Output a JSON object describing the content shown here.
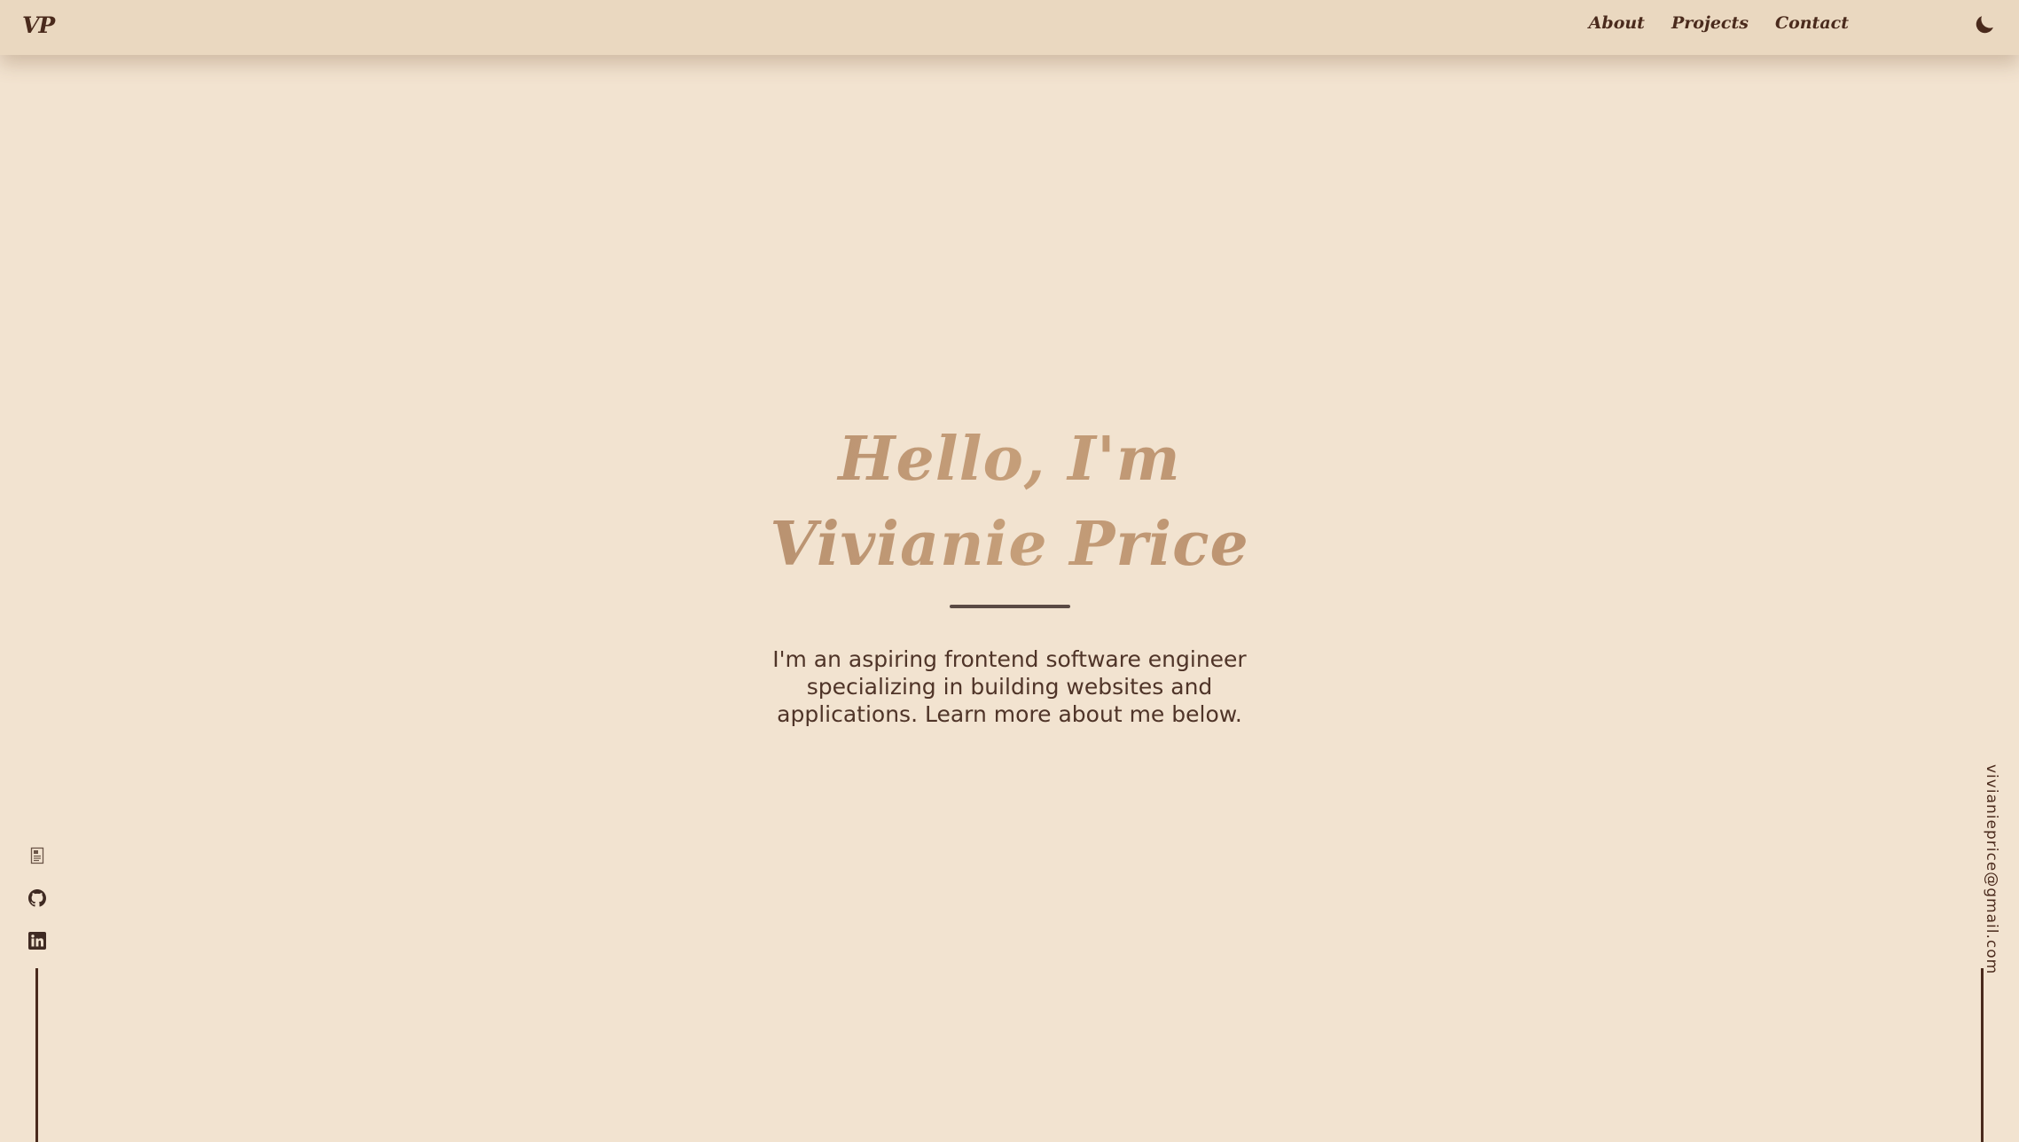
{
  "brand": {
    "logo": "VP"
  },
  "nav": {
    "links": [
      {
        "label": "About"
      },
      {
        "label": "Projects"
      },
      {
        "label": "Contact"
      }
    ],
    "theme_toggle_icon": "moon-icon"
  },
  "hero": {
    "title_line1": "Hello, I'm",
    "title_line2": "Vivianie Price",
    "description": "I'm an aspiring frontend software engineer specializing in building websites and applications. Learn more about me below."
  },
  "socials": [
    {
      "icon": "resume-icon"
    },
    {
      "icon": "github-icon"
    },
    {
      "icon": "linkedin-icon"
    }
  ],
  "email": "vivianieprice@gmail.com",
  "colors": {
    "background": "#f2e3d0",
    "navbar": "#ead8c0",
    "text_dark": "#4a2a1c",
    "title_gradient": [
      "#946c55",
      "#c59e79",
      "#a07359"
    ]
  }
}
